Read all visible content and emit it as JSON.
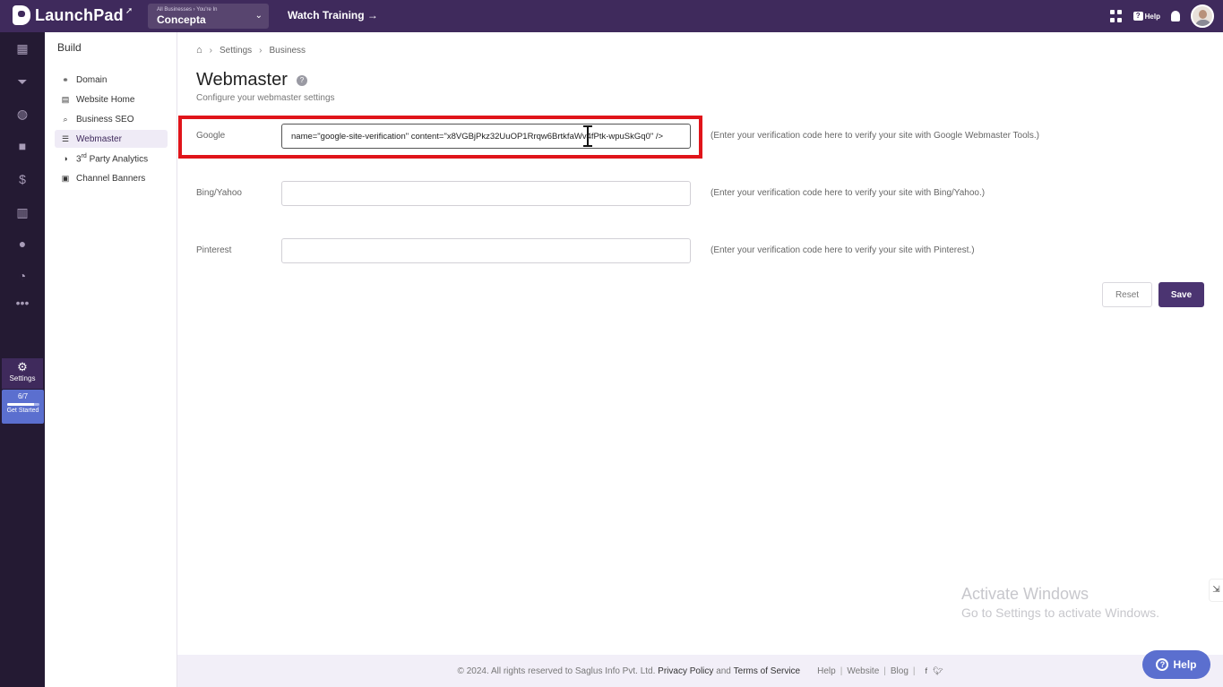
{
  "topbar": {
    "logo_text": "LaunchPad",
    "business_selector": {
      "caption": "All Businesses › You're In",
      "value": "Concepta"
    },
    "watch_training": "Watch Training →",
    "help_label": "Help"
  },
  "rail": {
    "icons": [
      "dashboard-icon",
      "funnel-icon",
      "globe-icon",
      "video-icon",
      "dollar-icon",
      "chart-icon",
      "users-icon",
      "speedometer-icon",
      "more-icon"
    ],
    "settings_label": "Settings",
    "progress": {
      "count": "6/7",
      "value": 0.857,
      "label": "Get Started"
    }
  },
  "subnav": {
    "title": "Build",
    "items": [
      {
        "label": "Domain",
        "icon": "domain-icon",
        "active": false
      },
      {
        "label": "Website Home",
        "icon": "website-icon",
        "active": false
      },
      {
        "label": "Business SEO",
        "icon": "search-icon",
        "active": false
      },
      {
        "label": "Webmaster",
        "icon": "webmaster-icon",
        "active": true
      },
      {
        "label_pre": "3",
        "label_sup": "rd",
        "label_post": " Party Analytics",
        "icon": "analytics-icon",
        "active": false
      },
      {
        "label": "Channel Banners",
        "icon": "banner-icon",
        "active": false
      }
    ]
  },
  "breadcrumb": [
    "Settings",
    "Business"
  ],
  "page": {
    "title": "Webmaster",
    "subtitle": "Configure your webmaster settings"
  },
  "form": {
    "google": {
      "label": "Google",
      "value": "name=\"google-site-verification\" content=\"x8VGBjPkz32UuOP1Rrqw6BrtkfaWv4fPtk-wpuSkGq0\" />",
      "help": "(Enter your verification code here to verify your site with Google Webmaster Tools.)"
    },
    "bing": {
      "label": "Bing/Yahoo",
      "value": "",
      "help": "(Enter your verification code here to verify your site with Bing/Yahoo.)"
    },
    "pinterest": {
      "label": "Pinterest",
      "value": "",
      "help": "(Enter your verification code here to verify your site with Pinterest.)"
    },
    "reset_label": "Reset",
    "save_label": "Save"
  },
  "footer": {
    "copyright": "©  2024. All rights reserved to Saglus Info Pvt. Ltd.",
    "privacy": "Privacy Policy",
    "and": "and",
    "terms": "Terms of Service",
    "links": [
      "Help",
      "Website",
      "Blog"
    ]
  },
  "watermark": {
    "line1": "Activate Windows",
    "line2": "Go to Settings to activate Windows."
  },
  "help_button": "Help",
  "colors": {
    "brand": "#3f2a5c",
    "rail_bg": "#241a33",
    "accent_blue": "#5b6fcf",
    "save_button": "#4b3471",
    "highlight_box": "#e0141a"
  }
}
